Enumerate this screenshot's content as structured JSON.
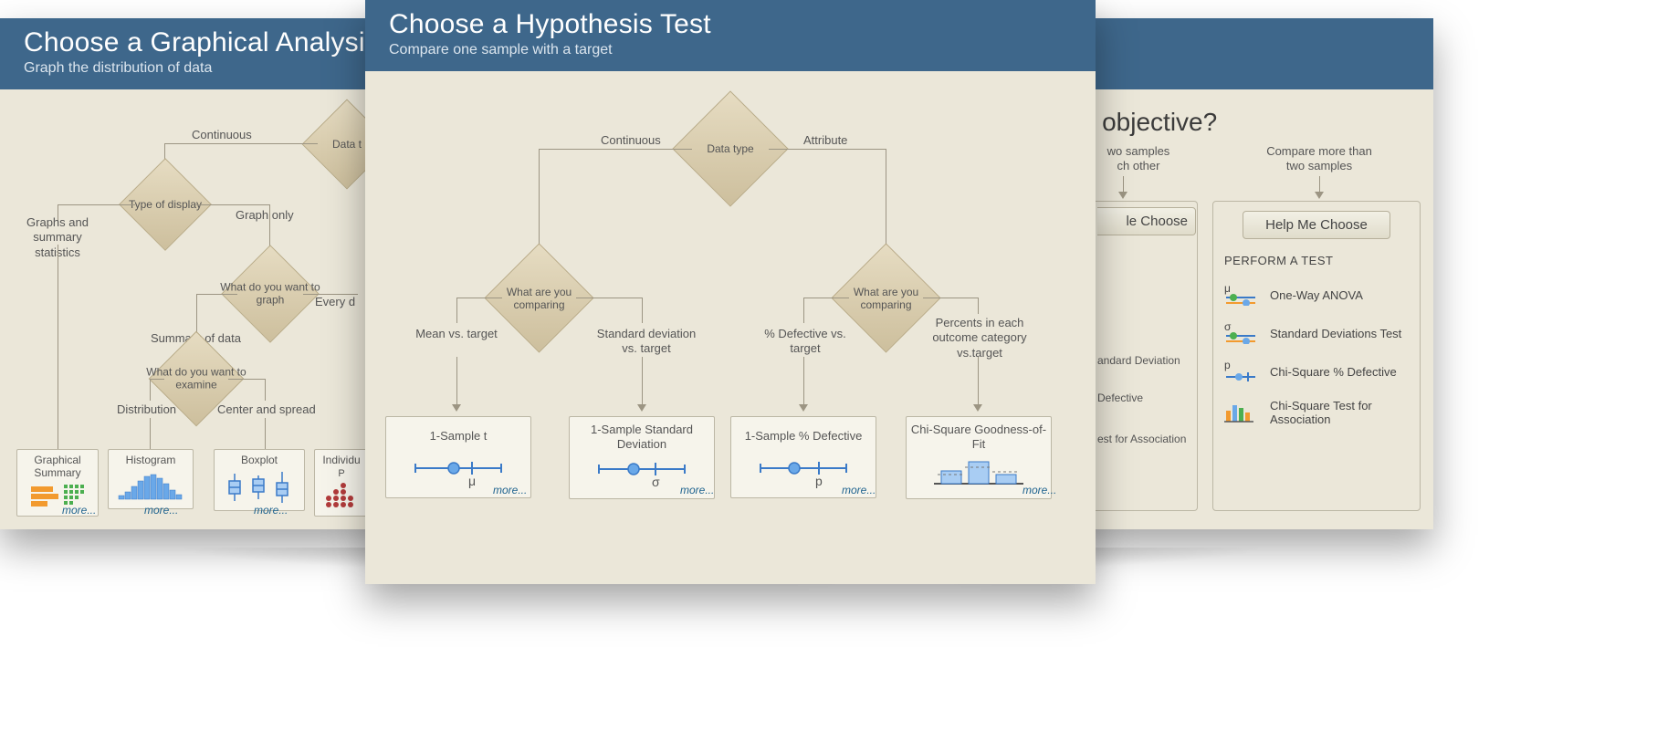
{
  "center": {
    "title": "Choose a Hypothesis Test",
    "subtitle": "Compare one sample with a target",
    "root": "Data type",
    "branch_left": "Continuous",
    "branch_right": "Attribute",
    "q_left": "What are you comparing",
    "q_right": "What are you comparing",
    "leaf1_label": "Mean vs. target",
    "leaf2_label": "Standard deviation vs. target",
    "leaf3_label": "% Defective vs. target",
    "leaf4_label": "Percents in each outcome category vs.target",
    "card1": "1-Sample t",
    "card2": "1-Sample Standard Deviation",
    "card3": "1-Sample % Defective",
    "card4": "Chi-Square Goodness-of-Fit",
    "sym_mu": "μ",
    "sym_sigma": "σ",
    "sym_p": "p",
    "more": "more..."
  },
  "left": {
    "title": "Choose a Graphical Analysis",
    "subtitle": "Graph the distribution of data",
    "root": "Data t",
    "branch_cont": "Continuous",
    "q_type": "Type of display",
    "lab_gs": "Graphs and summary statistics",
    "lab_go": "Graph only",
    "q_what_graph": "What do you want to graph",
    "lab_sum": "Summary of data",
    "lab_every": "Every d",
    "q_examine": "What do you want to examine",
    "lab_dist": "Distribution",
    "lab_cs": "Center and spread",
    "t1": "Graphical Summary",
    "t2": "Histogram",
    "t3": "Boxplot",
    "t4_frag": "Individu",
    "t4_frag2": "P",
    "more": "more..."
  },
  "right": {
    "heading_frag": "r objective?",
    "sub1": "wo samples\nch other",
    "sub2": "Compare more than two samples",
    "help_left": "le Choose",
    "help": "Help Me Choose",
    "perform": "PERFORM A TEST",
    "items": [
      "One-Way ANOVA",
      "Standard Deviations Test",
      "Chi-Square % Defective",
      "Chi-Square Test for Association"
    ],
    "sym_mu": "μ",
    "sym_sigma": "σ",
    "sym_p": "p",
    "peek1": "andard Deviation",
    "peek2": "Defective",
    "peek3": "est for Association"
  }
}
